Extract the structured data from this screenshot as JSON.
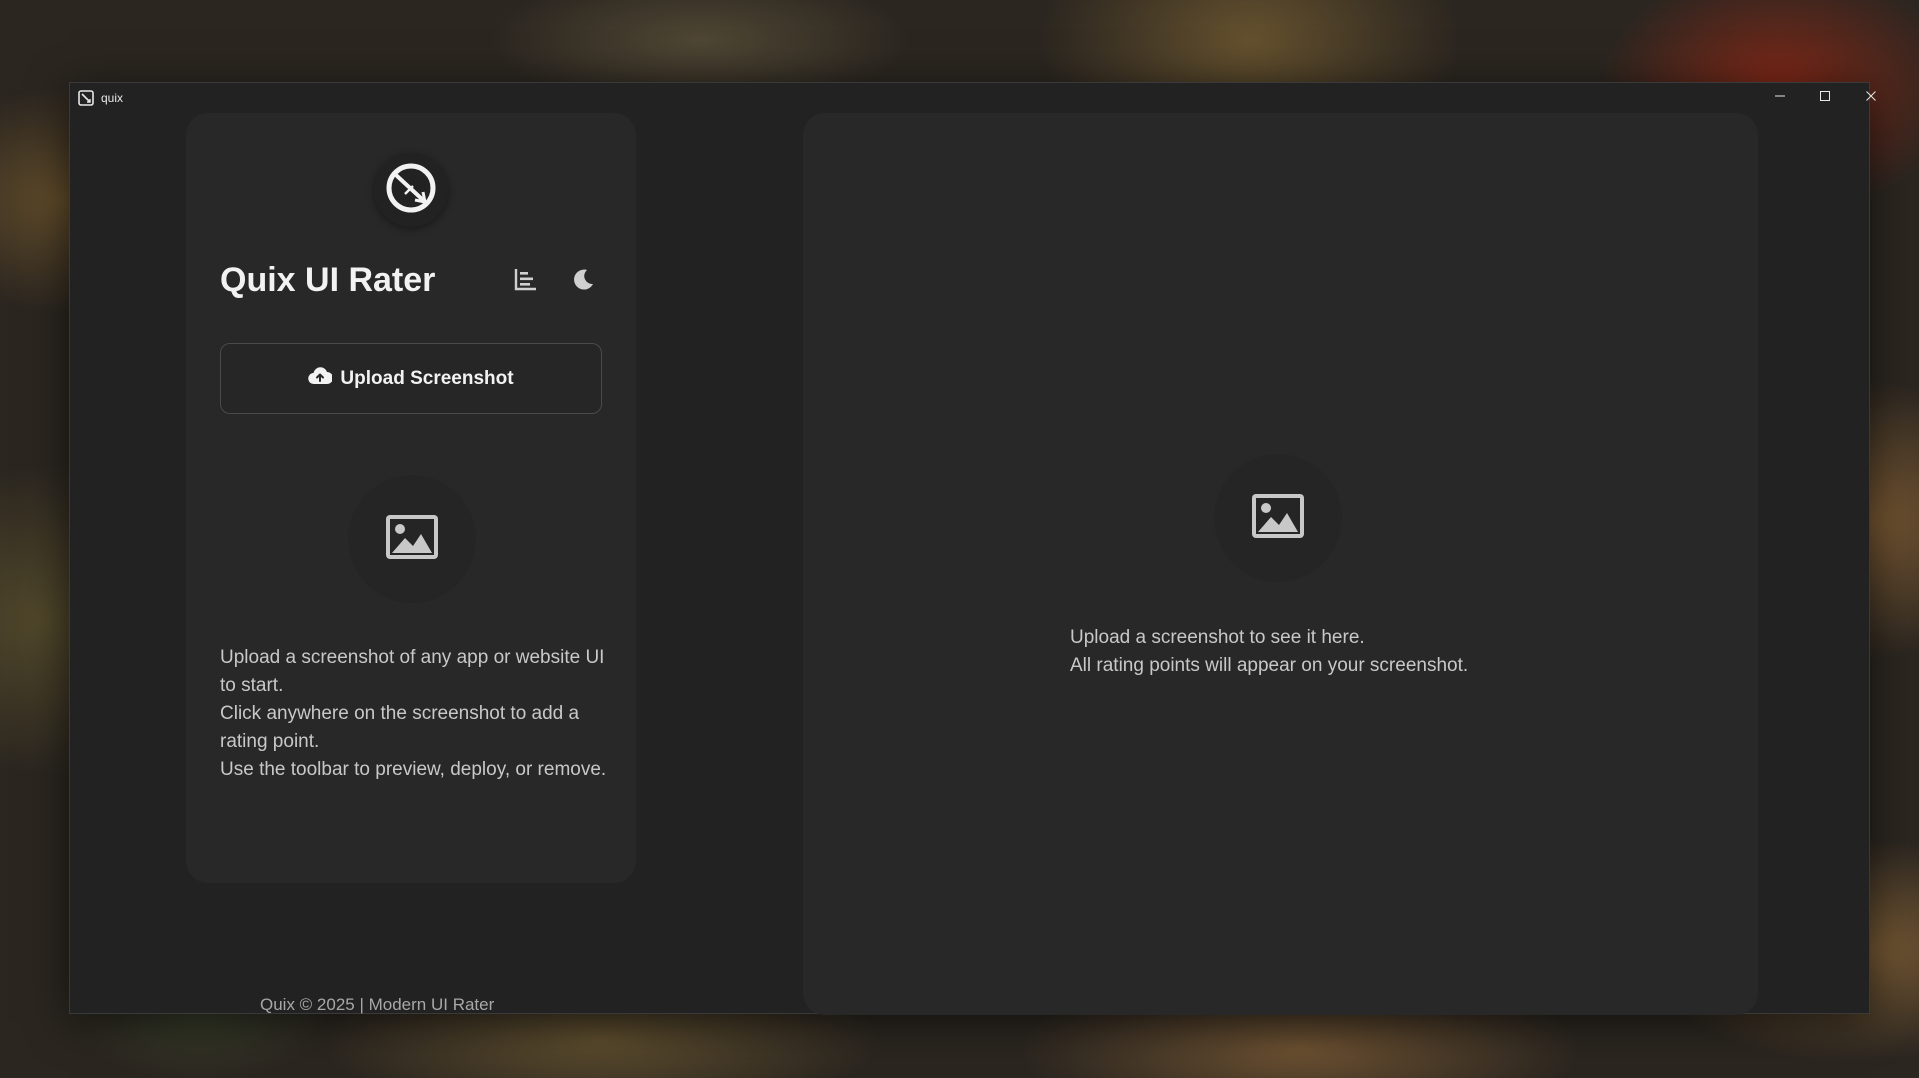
{
  "window": {
    "title": "quix",
    "app_icon": "quix-logo-icon",
    "controls": [
      "minimize-icon",
      "maximize-icon",
      "close-icon"
    ]
  },
  "sidebar": {
    "logo_icon": "quix-logo-icon",
    "title": "Quix UI Rater",
    "stats_icon": "bar-chart-icon",
    "theme_icon": "moon-icon",
    "upload_label": "Upload Screenshot",
    "upload_icon": "cloud-upload-icon",
    "placeholder_icon": "image-icon",
    "instructions": [
      "Upload a screenshot of any app or website UI to start.",
      "Click anywhere on the screenshot to add a rating point.",
      "Use the toolbar to preview, deploy, or remove."
    ]
  },
  "footer": {
    "text": "Quix © 2025 | Modern UI Rater"
  },
  "preview": {
    "placeholder_icon": "image-icon",
    "message_line1": "Upload a screenshot to see it here.",
    "message_line2": "All rating points will appear on your screenshot."
  },
  "colors": {
    "window_bg": "#222222",
    "panel_bg": "#282828",
    "text_primary": "#f2f2f2",
    "text_secondary": "#c8c8c8"
  }
}
